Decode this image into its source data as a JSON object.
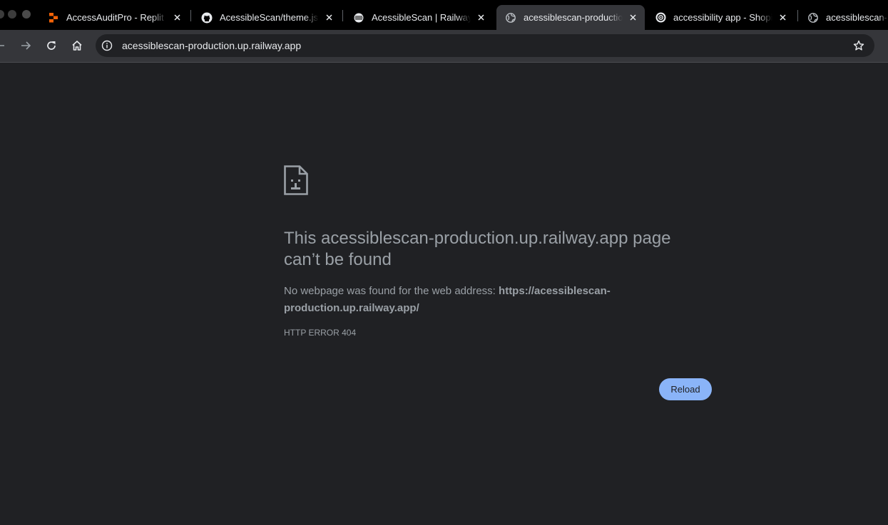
{
  "browser": {
    "tabs": [
      {
        "title": "AccessAuditPro - Replit",
        "favicon": "replit-icon",
        "active": false
      },
      {
        "title": "AcessibleScan/theme.json",
        "favicon": "github-icon",
        "active": false
      },
      {
        "title": "AcessibleScan | Railway",
        "favicon": "railway-icon",
        "active": false
      },
      {
        "title": "acessiblescan-production.up.railway.app",
        "favicon": "globe-icon",
        "active": true
      },
      {
        "title": "accessibility app - Shopify",
        "favicon": "openai-icon",
        "active": false
      },
      {
        "title": "acessiblescan-production",
        "favicon": "globe-icon",
        "active": false
      }
    ],
    "address_bar": {
      "url": "acessiblescan-production.up.railway.app"
    },
    "colors": {
      "tabstrip": "#000000",
      "toolbar": "#35363a",
      "page_background": "#202124",
      "accent": "#8ab4f8"
    }
  },
  "error_page": {
    "icon": "sad-document-icon",
    "heading": "This acessiblescan-production.up.railway.app page can’t be found",
    "description_prefix": "No webpage was found for the web address: ",
    "description_url": "https://acessiblescan-production.up.railway.app/",
    "error_code": "HTTP ERROR 404",
    "reload_label": "Reload"
  }
}
